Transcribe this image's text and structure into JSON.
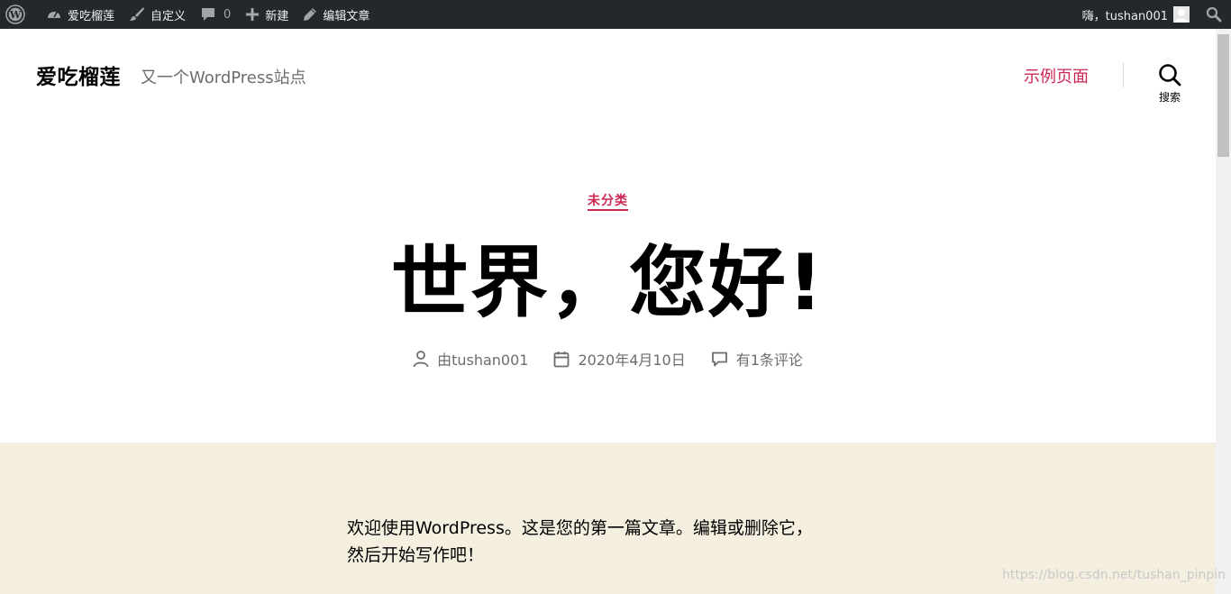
{
  "admin_bar": {
    "site_name": "爱吃榴莲",
    "customize": "自定义",
    "comments_count": "0",
    "new": "新建",
    "edit_post": "编辑文章",
    "greeting": "嗨，tushan001"
  },
  "header": {
    "site_title": "爱吃榴莲",
    "tagline": "又一个WordPress站点",
    "menu_item": "示例页面",
    "search_label": "搜索"
  },
  "post": {
    "category": "未分类",
    "title": "世界，您好!",
    "author": "由tushan001",
    "date": "2020年4月10日",
    "comments": "有1条评论",
    "content_line1": "欢迎使用WordPress。这是您的第一篇文章。编辑或删除它，",
    "content_line2": "然后开始写作吧！"
  },
  "watermark": "https://blog.csdn.net/tushan_pinpin",
  "colors": {
    "admin_bar_bg": "#23282d",
    "accent": "#cd2653",
    "content_bg": "#f5efe0",
    "meta_text": "#6d6d6d"
  }
}
